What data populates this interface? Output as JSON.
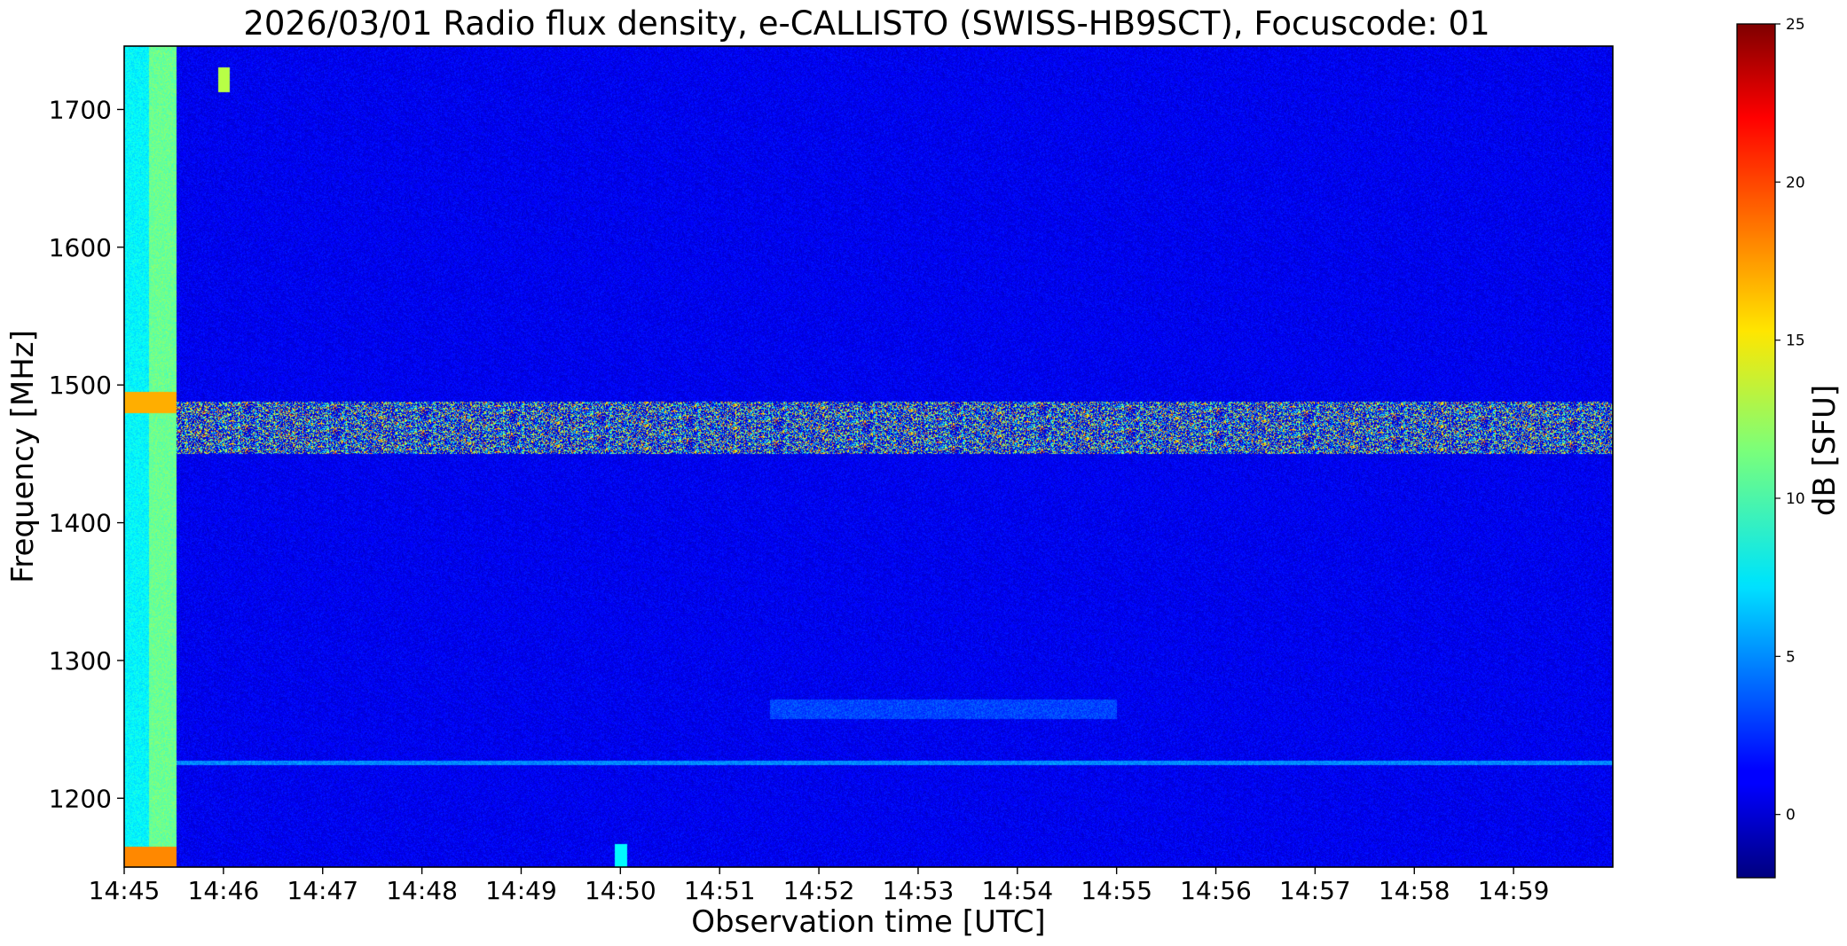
{
  "chart_data": {
    "type": "heatmap",
    "title": "2026/03/01  Radio flux density, e-CALLISTO (SWISS-HB9SCT), Focuscode: 01",
    "xlabel": "Observation time [UTC]",
    "ylabel": "Frequency [MHz]",
    "x_ticks": [
      "14:45",
      "14:46",
      "14:47",
      "14:48",
      "14:49",
      "14:50",
      "14:51",
      "14:52",
      "14:53",
      "14:54",
      "14:55",
      "14:56",
      "14:57",
      "14:58",
      "14:59"
    ],
    "x_range": [
      "14:45",
      "15:00"
    ],
    "y_ticks": [
      1200,
      1300,
      1400,
      1500,
      1600,
      1700
    ],
    "y_range": [
      1150,
      1746
    ],
    "colorbar": {
      "label": "dB [SFU]",
      "ticks": [
        0,
        5,
        10,
        15,
        20,
        25
      ],
      "range": [
        -2,
        25
      ],
      "colormap": "jet"
    },
    "features": {
      "background_level_db": 1,
      "rfi_band_mhz": [
        1450,
        1488
      ],
      "rfi_band_level_db": [
        0,
        20
      ],
      "calibration_columns_minutes": [
        [
          0,
          0.25,
          8
        ],
        [
          0.25,
          0.52,
          11
        ]
      ],
      "horizontal_line_mhz": 1226,
      "weak_emission": {
        "time_minutes": [
          6.5,
          10
        ],
        "freq_mhz": [
          1258,
          1272
        ],
        "level_db": 4
      },
      "spots": [
        {
          "time": "14:46",
          "freq_mhz": 1722,
          "level_db": 13
        },
        {
          "time": "14:50",
          "freq_mhz": 1158,
          "level_db": 8
        }
      ]
    }
  }
}
